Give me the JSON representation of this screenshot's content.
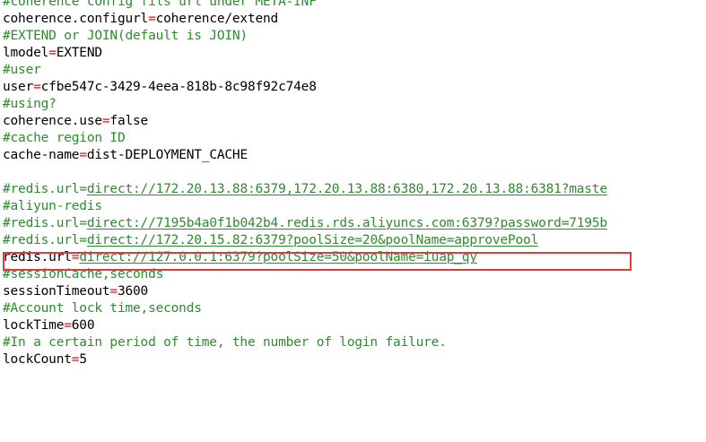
{
  "lines": [
    {
      "type": "comment",
      "text": "#coherence config fils url under META-INF"
    },
    {
      "type": "kv",
      "key": "coherence.configurl",
      "value": "coherence/extend"
    },
    {
      "type": "comment",
      "text": "#EXTEND or JOIN(default is JOIN)"
    },
    {
      "type": "kv",
      "key": "lmodel",
      "value": "EXTEND"
    },
    {
      "type": "comment",
      "text": "#user"
    },
    {
      "type": "kv",
      "key": "user",
      "value": "cfbe547c-3429-4eea-818b-8c98f92c74e8"
    },
    {
      "type": "comment",
      "text": "#using?"
    },
    {
      "type": "kv",
      "key": "coherence.use",
      "value": "false"
    },
    {
      "type": "comment",
      "text": "#cache region ID"
    },
    {
      "type": "kv",
      "key": "cache-name",
      "value": "dist-DEPLOYMENT_CACHE"
    },
    {
      "type": "blank",
      "text": ""
    },
    {
      "type": "comment-url",
      "key": "#redis.url",
      "url": "direct://172.20.13.88:6379,172.20.13.88:6380,172.20.13.88:6381?maste"
    },
    {
      "type": "comment",
      "text": "#aliyun-redis"
    },
    {
      "type": "comment-url",
      "key": "#redis.url",
      "url": "direct://7195b4a0f1b042b4.redis.rds.aliyuncs.com:6379?password=7195b"
    },
    {
      "type": "comment-url",
      "key": "#redis.url",
      "url": "direct://172.20.15.82:6379?poolSize=20&poolName=approvePool"
    },
    {
      "type": "kv-url",
      "key": "redis.url",
      "url": "direct://127.0.0.1:6379?poolSize=50&poolName=iuap_qy"
    },
    {
      "type": "comment",
      "text": "#sessionCache,seconds"
    },
    {
      "type": "kv",
      "key": "sessionTimeout",
      "value": "3600"
    },
    {
      "type": "comment",
      "text": "#Account lock time,seconds"
    },
    {
      "type": "kv",
      "key": "lockTime",
      "value": "600"
    },
    {
      "type": "comment",
      "text": "#In a certain period of time, the number of login failure."
    },
    {
      "type": "kv",
      "key": "lockCount",
      "value": "5"
    }
  ],
  "highlight": {
    "line_index": 15
  },
  "colors": {
    "comment": "#2e8b2e",
    "equals": "#ff0000",
    "text": "#000000",
    "highlight_border": "#e03a3a"
  }
}
